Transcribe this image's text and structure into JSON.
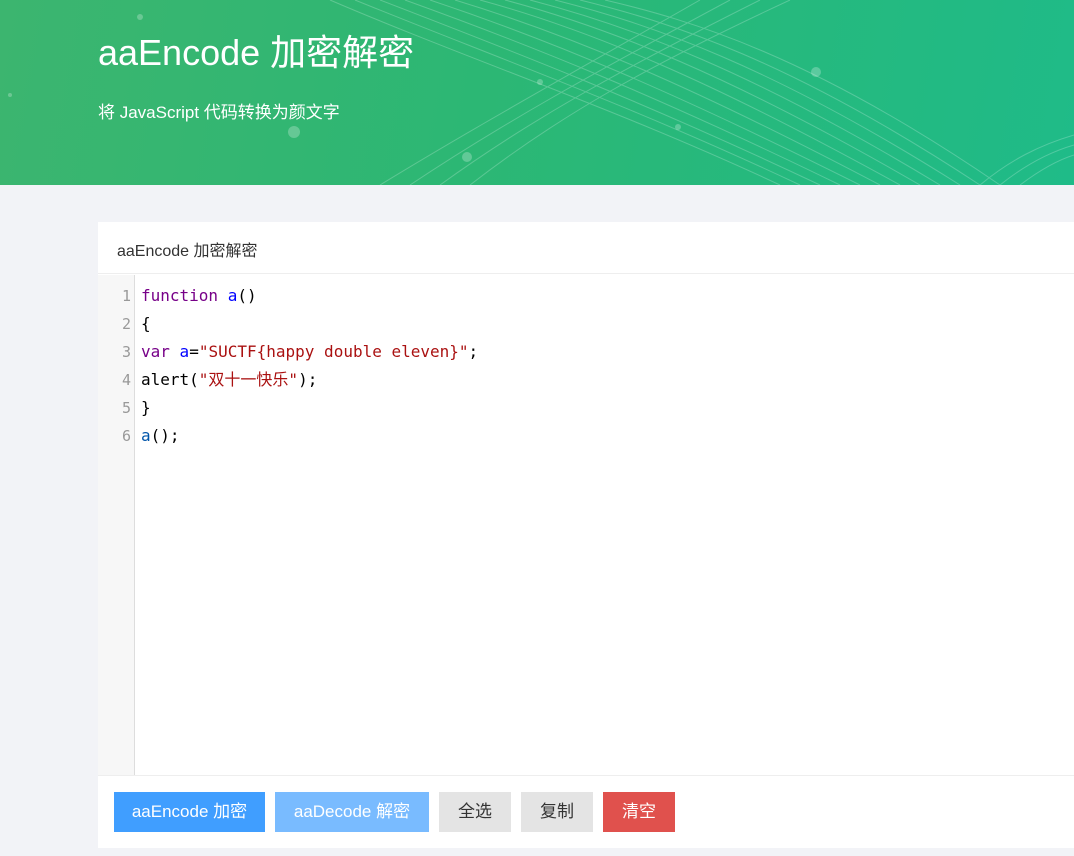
{
  "header": {
    "title": "aaEncode 加密解密",
    "subtitle": "将 JavaScript 代码转换为颜文字"
  },
  "card": {
    "title": "aaEncode 加密解密"
  },
  "editor": {
    "lines": [
      {
        "number": "1",
        "tokens": [
          {
            "t": "function",
            "c": "kw"
          },
          {
            "t": " ",
            "c": "plain"
          },
          {
            "t": "a",
            "c": "def"
          },
          {
            "t": "()",
            "c": "plain"
          }
        ]
      },
      {
        "number": "2",
        "tokens": [
          {
            "t": "{",
            "c": "plain"
          }
        ]
      },
      {
        "number": "3",
        "tokens": [
          {
            "t": "var",
            "c": "kw"
          },
          {
            "t": " ",
            "c": "plain"
          },
          {
            "t": "a",
            "c": "def"
          },
          {
            "t": "=",
            "c": "plain"
          },
          {
            "t": "\"SUCTF{happy double eleven}\"",
            "c": "str"
          },
          {
            "t": ";",
            "c": "plain"
          }
        ]
      },
      {
        "number": "4",
        "tokens": [
          {
            "t": "alert(",
            "c": "plain"
          },
          {
            "t": "\"双十一快乐\"",
            "c": "str"
          },
          {
            "t": ");",
            "c": "plain"
          }
        ]
      },
      {
        "number": "5",
        "tokens": [
          {
            "t": "}",
            "c": "plain"
          }
        ]
      },
      {
        "number": "6",
        "tokens": [
          {
            "t": "a",
            "c": "var"
          },
          {
            "t": "();",
            "c": "plain"
          }
        ]
      }
    ]
  },
  "buttons": {
    "encode": "aaEncode 加密",
    "decode": "aaDecode 解密",
    "select_all": "全选",
    "copy": "复制",
    "clear": "清空"
  },
  "colors": {
    "banner_start": "#3cb56f",
    "banner_end": "#1fbb88",
    "primary": "#409eff",
    "primary_light": "#79bbff",
    "danger": "#e0514d"
  }
}
